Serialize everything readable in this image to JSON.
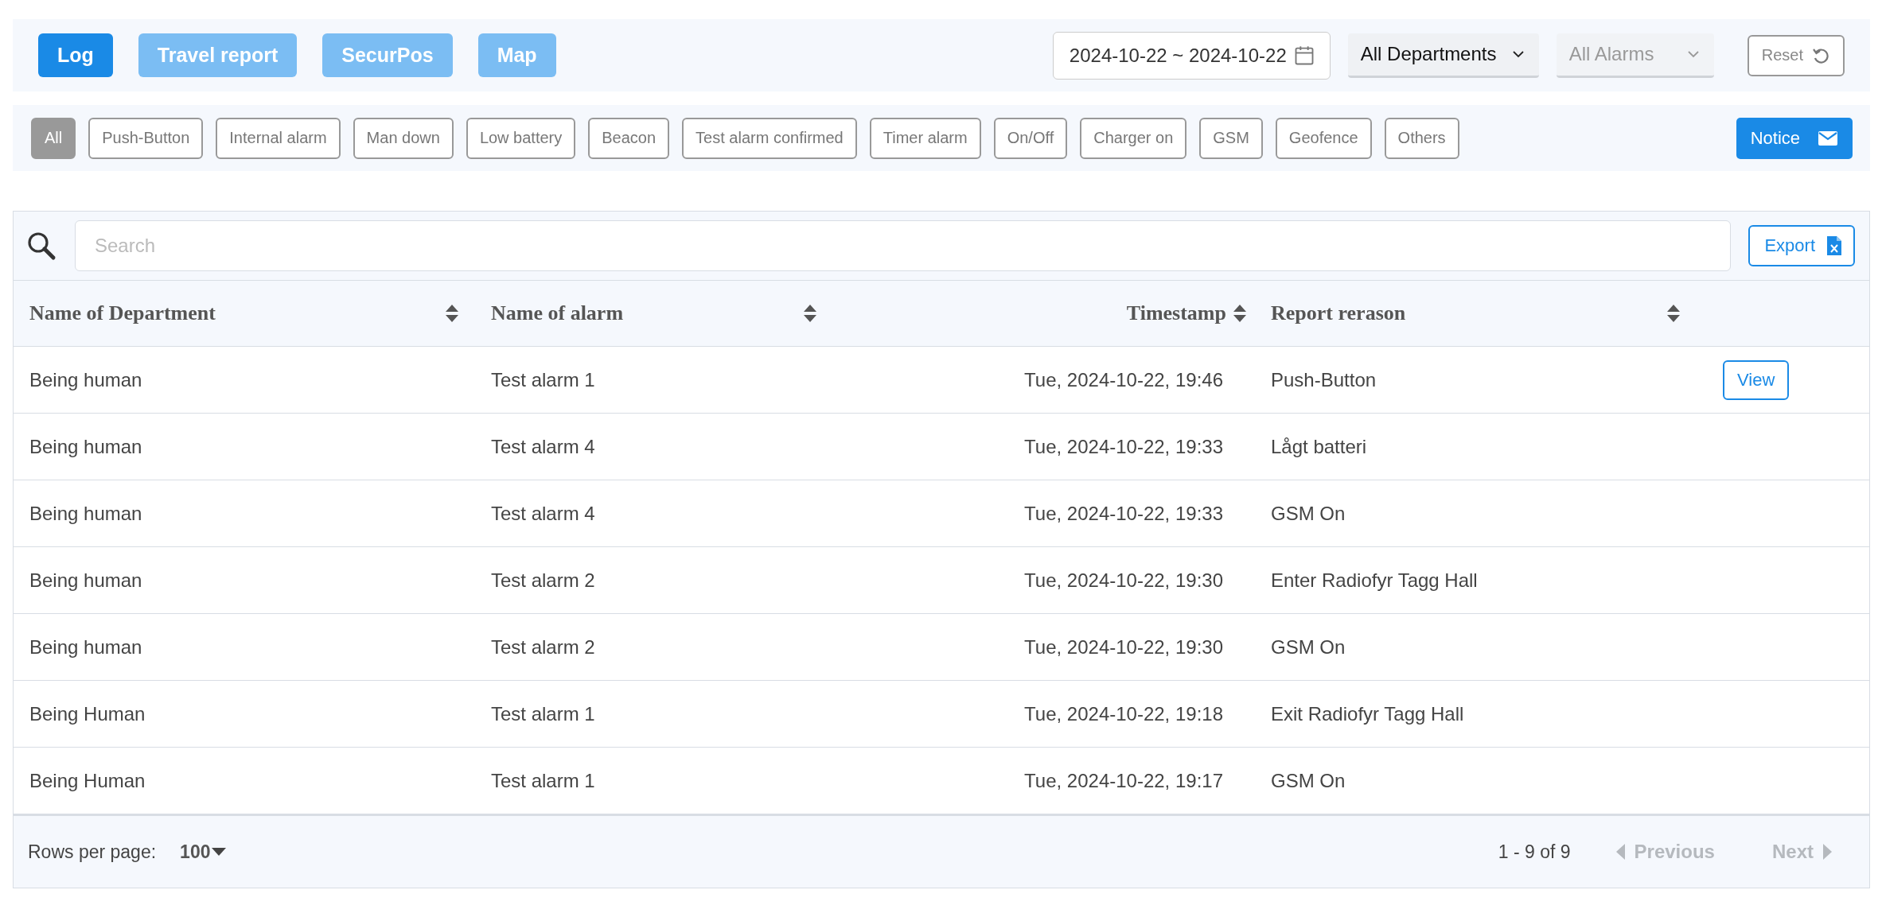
{
  "nav_tabs": [
    {
      "label": "Log",
      "selected": true
    },
    {
      "label": "Travel report",
      "selected": false
    },
    {
      "label": "SecurPos",
      "selected": false
    },
    {
      "label": "Map",
      "selected": false
    }
  ],
  "date_range": {
    "value": "2024-10-22 ~ 2024-10-22"
  },
  "department_select": {
    "value": "All Departments",
    "disabled": false
  },
  "alarm_select": {
    "value": "All Alarms",
    "disabled": true
  },
  "reset_button": {
    "label": "Reset"
  },
  "filters": [
    {
      "label": "All",
      "selected": true
    },
    {
      "label": "Push-Button",
      "selected": false
    },
    {
      "label": "Internal alarm",
      "selected": false
    },
    {
      "label": "Man down",
      "selected": false
    },
    {
      "label": "Low battery",
      "selected": false
    },
    {
      "label": "Beacon",
      "selected": false
    },
    {
      "label": "Test alarm confirmed",
      "selected": false
    },
    {
      "label": "Timer alarm",
      "selected": false
    },
    {
      "label": "On/Off",
      "selected": false
    },
    {
      "label": "Charger on",
      "selected": false
    },
    {
      "label": "GSM",
      "selected": false
    },
    {
      "label": "Geofence",
      "selected": false
    },
    {
      "label": "Others",
      "selected": false
    }
  ],
  "notice_button": {
    "label": "Notice"
  },
  "search": {
    "placeholder": "Search"
  },
  "export_button": {
    "label": "Export"
  },
  "table": {
    "columns": [
      {
        "label": "Name of Department",
        "kind": "text"
      },
      {
        "label": "Name of alarm",
        "kind": "text"
      },
      {
        "label": "Timestamp",
        "kind": "time"
      },
      {
        "label": "Report rerason",
        "kind": "text"
      }
    ],
    "rows": [
      {
        "cells": [
          "Being human",
          "Test alarm 1",
          "Tue, 2024-10-22, 19:46",
          "Push-Button"
        ],
        "action": "View"
      },
      {
        "cells": [
          "Being human",
          "Test alarm 4",
          "Tue, 2024-10-22, 19:33",
          "Lågt batteri"
        ]
      },
      {
        "cells": [
          "Being human",
          "Test alarm 4",
          "Tue, 2024-10-22, 19:33",
          "GSM On"
        ]
      },
      {
        "cells": [
          "Being human",
          "Test alarm 2",
          "Tue, 2024-10-22, 19:30",
          "Enter Radiofyr Tagg Hall"
        ]
      },
      {
        "cells": [
          "Being human",
          "Test alarm 2",
          "Tue, 2024-10-22, 19:30",
          "GSM On"
        ]
      },
      {
        "cells": [
          "Being Human",
          "Test alarm 1",
          "Tue, 2024-10-22, 19:18",
          "Exit Radiofyr Tagg Hall"
        ]
      },
      {
        "cells": [
          "Being Human",
          "Test alarm 1",
          "Tue, 2024-10-22, 19:17",
          "GSM On"
        ]
      }
    ]
  },
  "footer": {
    "rows_per_page_label": "Rows per page:",
    "rows_per_page_value": "100",
    "range": "1 - 9 of 9",
    "previous": {
      "label": "Previous",
      "disabled": true
    },
    "next": {
      "label": "Next",
      "disabled": true
    }
  }
}
